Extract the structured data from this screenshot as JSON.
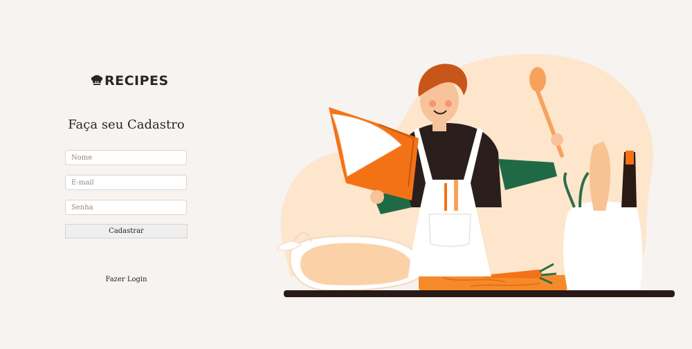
{
  "brand": {
    "name": "RECIPES",
    "icon": "chef-hat-icon"
  },
  "form": {
    "title": "Faça seu Cadastro",
    "name_placeholder": "Nome",
    "email_placeholder": "E-mail",
    "password_placeholder": "Senha",
    "submit_label": "Cadastrar",
    "login_link": "Fazer Login"
  },
  "colors": {
    "background": "#f6f3f0",
    "accent_orange": "#f47216",
    "dark": "#2a2522"
  },
  "illustration": {
    "subject": "chef-with-cookbook-illustration"
  }
}
